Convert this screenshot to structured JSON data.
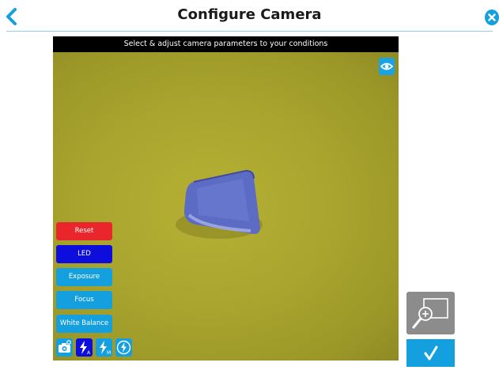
{
  "header": {
    "title": "Configure Camera",
    "back_icon": "chevron-left-icon",
    "close_icon": "close-circle-icon"
  },
  "camera": {
    "caption": "Select & adjust camera parameters to your conditions",
    "preview_icon": "eye-icon"
  },
  "controls": {
    "reset_label": "Reset",
    "led_label": "LED",
    "exposure_label": "Exposure",
    "focus_label": "Focus",
    "white_balance_label": "White Balance"
  },
  "toolbar": {
    "icons": [
      "camera-settings-icon",
      "flash-auto-icon",
      "flash-manual-icon",
      "flash-off-icon"
    ]
  },
  "side": {
    "zoom_icon": "zoom-in-icon",
    "confirm_icon": "checkmark-icon"
  },
  "colors": {
    "accent": "#14a0df",
    "reset": "#e8262b",
    "led": "#0d0ddc",
    "field": "#a8a232",
    "object": "#5c6cc4"
  }
}
